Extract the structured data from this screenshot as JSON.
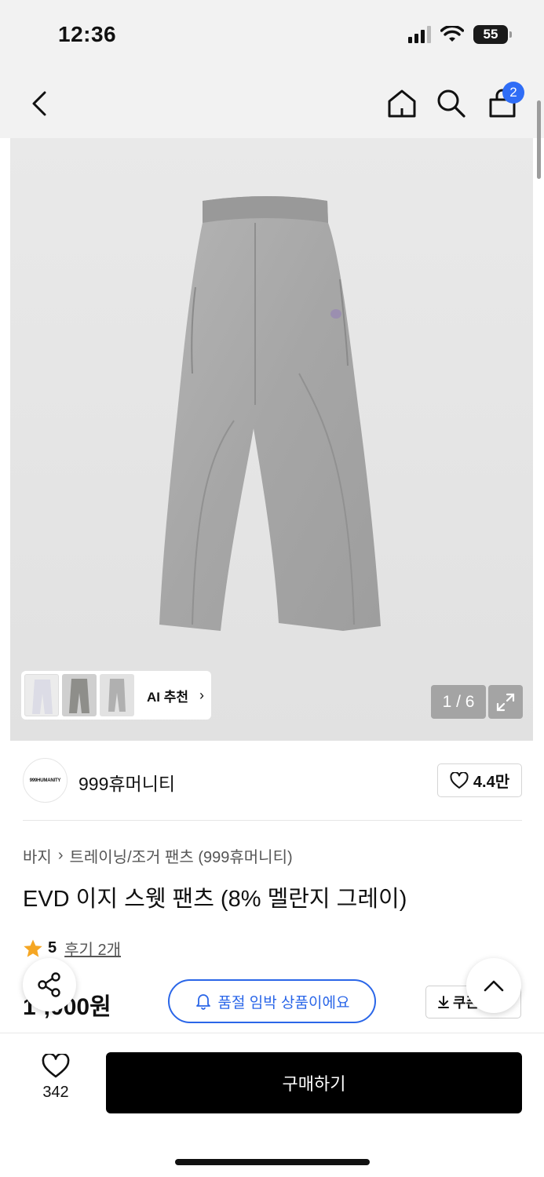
{
  "status_bar": {
    "time": "12:36",
    "battery": "55"
  },
  "nav": {
    "cart_count": "2"
  },
  "gallery": {
    "counter": "1 / 6",
    "ai_label": "AI 추천",
    "ai_chevron": "›"
  },
  "brand": {
    "logo_text": "999HUMANITY",
    "name": "999휴머니티",
    "likes": "4.4만"
  },
  "breadcrumb": {
    "category": "바지",
    "separator": "›",
    "subcategory": "트레이닝/조거 팬츠 (999휴머니티)"
  },
  "product": {
    "title": "EVD 이지 스웻 팬츠 (8% 멜란지 그레이)",
    "rating": "5",
    "reviews": "후기 2개",
    "price": "1·,000원",
    "stock_notice": "품절 임박 상품이에요",
    "coupon_label": "쿠폰"
  },
  "bottom_bar": {
    "wish_count": "342",
    "buy_label": "구매하기"
  },
  "colors": {
    "accent": "#2a66e8",
    "badge": "#2f6df6",
    "star": "#f5a623",
    "buy_button": "#000000"
  },
  "icons": [
    "back-icon",
    "home-icon",
    "search-icon",
    "cart-icon",
    "expand-icon",
    "heart-icon",
    "star-icon",
    "bell-icon",
    "download-icon",
    "share-icon",
    "chevron-up-icon"
  ]
}
